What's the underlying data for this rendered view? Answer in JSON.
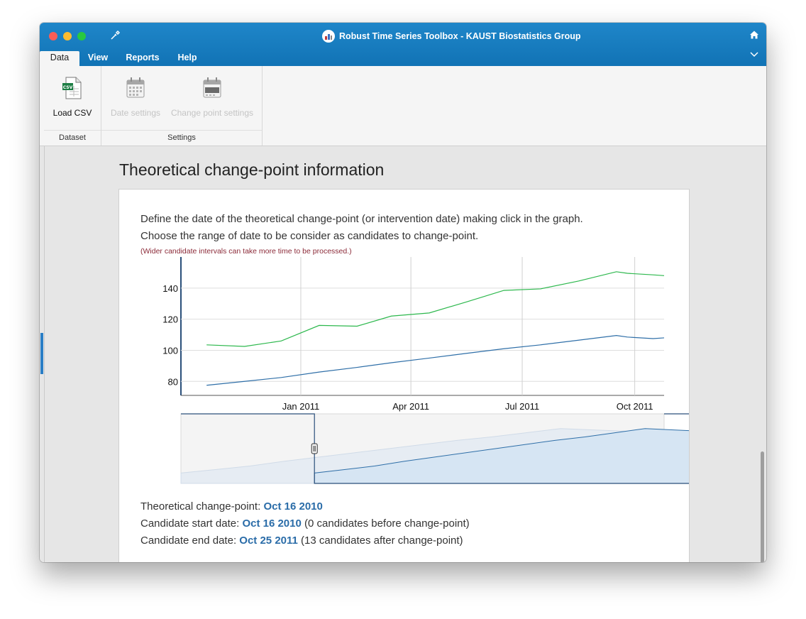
{
  "window": {
    "title": "Robust Time Series Toolbox - KAUST Biostatistics Group"
  },
  "menu": {
    "tabs": [
      {
        "label": "Data"
      },
      {
        "label": "View"
      },
      {
        "label": "Reports"
      },
      {
        "label": "Help"
      }
    ],
    "active_tab": "Data"
  },
  "ribbon": {
    "groups": [
      {
        "label": "Dataset",
        "buttons": [
          {
            "label": "Load CSV",
            "icon": "csv-file-icon",
            "enabled": true
          }
        ]
      },
      {
        "label": "Settings",
        "buttons": [
          {
            "label": "Date settings",
            "icon": "calendar-icon",
            "enabled": false
          },
          {
            "label": "Change point settings",
            "icon": "calendar-changepoint-icon",
            "enabled": false
          }
        ]
      }
    ]
  },
  "page": {
    "heading": "Theoretical change-point information",
    "instruction_1": "Define the date of the theoretical change-point (or intervention date) making click in the graph.",
    "instruction_2": "Choose the range of date to be consider as candidates to change-point.",
    "warning": "(Wider candidate intervals can take more time to be processed.)",
    "colors": {
      "green_series": "#2db84d",
      "blue_series": "#2f6fa8",
      "link": "#2a6ca8",
      "warning": "#8b2a38",
      "navigator_fill": "#d6e5f3"
    }
  },
  "chart_data": {
    "type": "line",
    "title": "",
    "xlabel": "",
    "ylabel": "",
    "x_ticks": [
      "Jan 2011",
      "Apr 2011",
      "Jul 2011",
      "Oct 2011"
    ],
    "y_ticks": [
      80,
      100,
      120,
      140
    ],
    "ylim": [
      71,
      160
    ],
    "grid": true,
    "x": [
      "2010-10-16",
      "2010-11-16",
      "2010-12-16",
      "2011-01-16",
      "2011-02-16",
      "2011-03-16",
      "2011-04-16",
      "2011-05-16",
      "2011-06-16",
      "2011-07-16",
      "2011-08-16",
      "2011-09-16",
      "2011-09-25",
      "2011-10-16",
      "2011-10-25"
    ],
    "series": [
      {
        "values": [
          103.5,
          102.5,
          106,
          116,
          115.5,
          122,
          124,
          131,
          138.5,
          139.5,
          144.5,
          150.5,
          149.5,
          148.5,
          148
        ]
      },
      {
        "values": [
          77.5,
          80,
          82.5,
          86,
          89,
          92,
          95,
          98,
          101,
          103.5,
          106.5,
          109.5,
          108.5,
          107.5,
          108
        ]
      }
    ],
    "navigator": {
      "type": "area",
      "selected_start": "2010-10-16",
      "selected_end": "2011-10-25"
    }
  },
  "info": {
    "changepoint_label": "Theoretical change-point:",
    "changepoint_date": "Oct 16 2010",
    "start_label": "Candidate start date:",
    "start_date": "Oct 16 2010",
    "start_note": "(0 candidates before change-point)",
    "end_label": "Candidate end date:",
    "end_date": "Oct 25 2011",
    "end_note": "(13 candidates after change-point)"
  }
}
